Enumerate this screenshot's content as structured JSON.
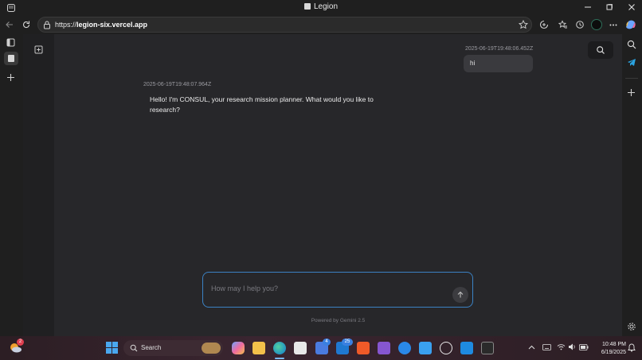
{
  "browser": {
    "tab_title": "Legion",
    "url_prefix": "https://",
    "url_host": "legion-six.vercel.app"
  },
  "chat": {
    "messages": [
      {
        "role": "user",
        "timestamp": "2025-06-19T19:48:06.452Z",
        "text": "hi"
      },
      {
        "role": "assistant",
        "timestamp": "2025-06-19T19:48:07.964Z",
        "text": "Hello! I'm CONSUL, your research mission planner. What would you like to research?"
      }
    ],
    "input_placeholder": "How may I help you?",
    "footer": "Powered by Gemini 2.5"
  },
  "taskbar": {
    "search_label": "Search",
    "time": "10:48 PM",
    "date": "6/19/2025",
    "badges": {
      "weather": "2",
      "teams": "4",
      "outlook": "25"
    }
  },
  "colors": {
    "accent_border": "#3b82c4",
    "page_bg": "#27272a",
    "sidebar_bg": "#202022"
  }
}
